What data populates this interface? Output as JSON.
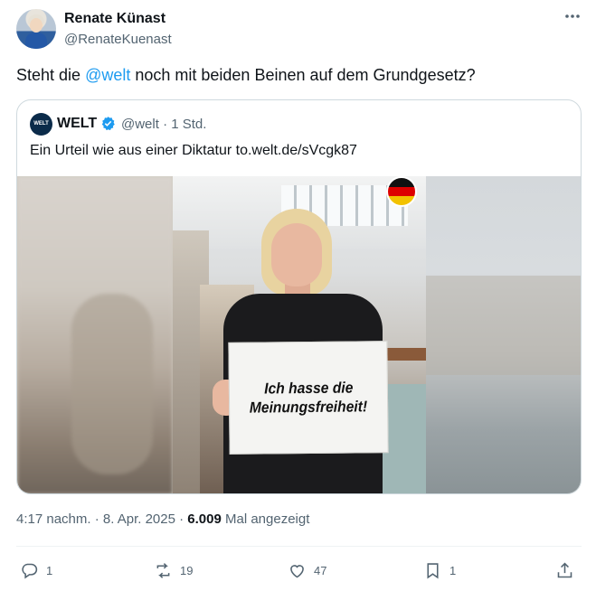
{
  "author": {
    "display_name": "Renate Künast",
    "handle": "@RenateKuenast"
  },
  "tweet": {
    "text_before": "Steht die ",
    "mention": "@welt",
    "text_after": " noch mit beiden Beinen auf dem Grundgesetz?"
  },
  "quoted": {
    "avatar_label": "WELT",
    "name": "WELT",
    "meta": "@welt · 1 Std.",
    "text": "Ein Urteil wie aus einer Diktatur to.welt.de/sVcgk87",
    "image_sign_line1": "Ich hasse die",
    "image_sign_line2": "Meinungsfreiheit!"
  },
  "meta_row": {
    "timestamp": "4:17 nachm. · 8. Apr. 2025 · ",
    "views_count": "6.009",
    "views_label": " Mal angezeigt"
  },
  "actions": {
    "reply_count": "1",
    "repost_count": "19",
    "like_count": "47",
    "bookmark_count": "1"
  },
  "icons": {
    "more": "more-icon",
    "verified": "verified-badge-icon",
    "reply": "reply-icon",
    "repost": "repost-icon",
    "like": "heart-icon",
    "bookmark": "bookmark-icon",
    "share": "share-icon"
  },
  "colors": {
    "accent": "#1d9bf0",
    "secondary_text": "#536471",
    "border": "#cfd9de"
  }
}
